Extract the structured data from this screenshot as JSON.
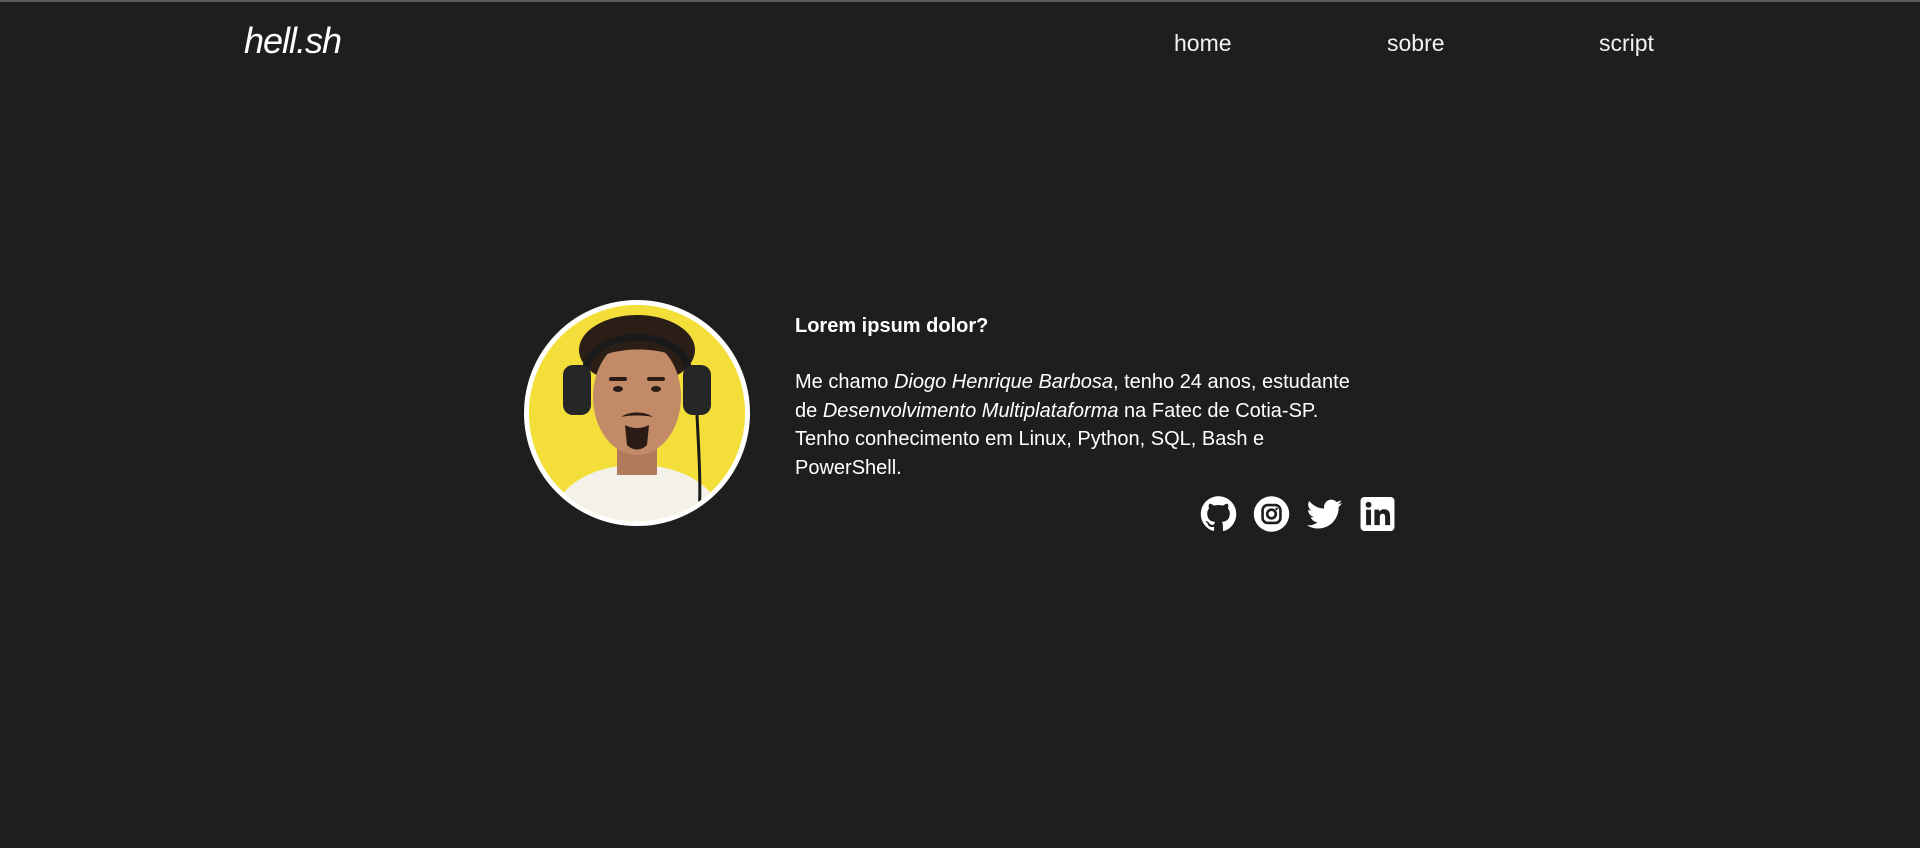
{
  "nav": {
    "logo": "hell.sh",
    "links": [
      {
        "label": "home"
      },
      {
        "label": "sobre"
      },
      {
        "label": "script"
      }
    ]
  },
  "about": {
    "title": "Lorem ipsum dolor?",
    "text_1": "Me chamo ",
    "name": "Diogo Henrique Barbosa",
    "text_2": ", tenho 24 anos, estudante de ",
    "course": "Desenvolvimento Multiplataforma",
    "text_3": " na Fatec de Cotia-SP. Tenho conhecimento em Linux, Python, SQL, Bash e PowerShell."
  },
  "avatar": {
    "background_color": "#f4df3a",
    "border_color": "#ffffff"
  },
  "socials": [
    {
      "icon": "github-icon"
    },
    {
      "icon": "instagram-icon"
    },
    {
      "icon": "twitter-icon"
    },
    {
      "icon": "linkedin-icon"
    }
  ],
  "colors": {
    "background": "#1e1e1e",
    "text": "#ffffff"
  }
}
